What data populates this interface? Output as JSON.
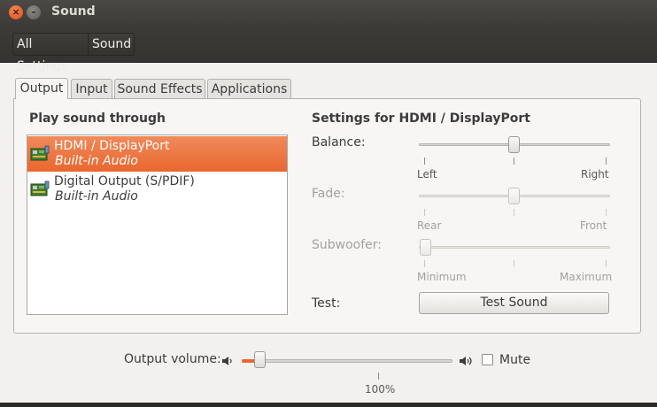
{
  "window": {
    "title": "Sound",
    "close_glyph": "×",
    "min_glyph": "–"
  },
  "toolbar": {
    "all_settings": "All Settings",
    "sound": "Sound"
  },
  "tabs": [
    "Output",
    "Input",
    "Sound Effects",
    "Applications"
  ],
  "output": {
    "play_title": "Play sound through",
    "devices": [
      {
        "name": "HDMI / DisplayPort",
        "sub": "Built-in Audio",
        "selected": true,
        "icon": "audio-card-icon"
      },
      {
        "name": "Digital Output (S/PDIF)",
        "sub": "Built-in Audio",
        "selected": false,
        "icon": "audio-card-icon"
      }
    ],
    "settings_title": "Settings for HDMI / DisplayPort",
    "balance": {
      "label": "Balance:",
      "left": "Left",
      "right": "Right",
      "value": 0.5
    },
    "fade": {
      "label": "Fade:",
      "left": "Rear",
      "right": "Front",
      "value": 0.5,
      "enabled": false
    },
    "subwoofer": {
      "label": "Subwoofer:",
      "left": "Minimum",
      "right": "Maximum",
      "value": 0.0,
      "enabled": false
    },
    "test_label": "Test:",
    "test_button": "Test Sound"
  },
  "volume": {
    "label": "Output volume:",
    "value_percent": 10,
    "mark_label": "100%",
    "mute_label": "Mute",
    "muted": false,
    "low_icon": "speaker-low-icon",
    "high_icon": "speaker-high-icon"
  },
  "colors": {
    "accent": "#e9672f",
    "titlebar": "#3c3b37"
  }
}
